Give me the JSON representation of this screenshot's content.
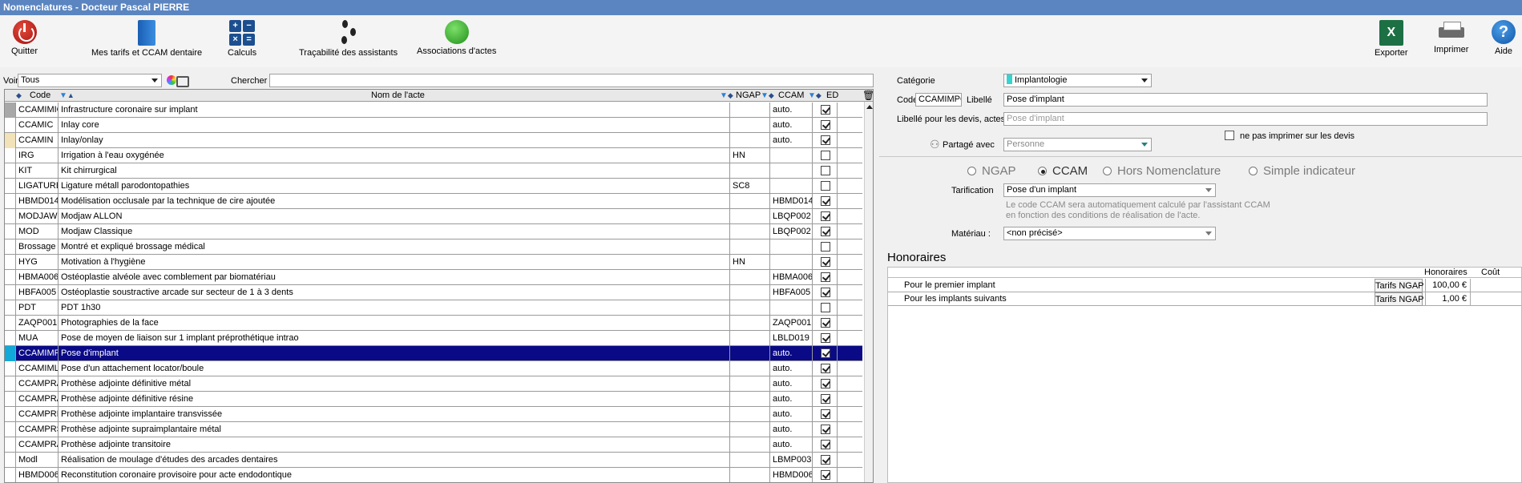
{
  "window": {
    "title": "Nomenclatures - Docteur Pascal PIERRE"
  },
  "toolbar": {
    "quit": "Quitter",
    "tarifs": "Mes tarifs et CCAM dentaire",
    "calculs": "Calculs",
    "calc_symbols": [
      "+",
      "−",
      "×",
      "="
    ],
    "tracabilite": "Traçabilité des assistants",
    "associations": "Associations d'actes",
    "export": "Exporter",
    "export_glyph": "X",
    "print": "Imprimer",
    "help": "Aide",
    "help_glyph": "?"
  },
  "filter": {
    "voir_label": "Voir",
    "voir_value": "Tous",
    "search_label": "Chercher",
    "search_value": ""
  },
  "grid": {
    "headers": {
      "code": "Code",
      "name": "Nom de l'acte",
      "ngap": "NGAP",
      "ccam": "CCAM",
      "ed": "ED"
    },
    "rows": [
      {
        "mark": "#a8a8a8",
        "code": "CCAMIMIC",
        "name": "Infrastructure coronaire sur implant",
        "ngap": "",
        "ccam": "auto.",
        "ed": true
      },
      {
        "mark": "",
        "code": "CCAMIC",
        "name": "Inlay core",
        "ngap": "",
        "ccam": "auto.",
        "ed": true
      },
      {
        "mark": "#f2e2b8",
        "code": "CCAMIN",
        "name": "Inlay/onlay",
        "ngap": "",
        "ccam": "auto.",
        "ed": true
      },
      {
        "mark": "",
        "code": "IRG",
        "name": "Irrigation à l'eau oxygénée",
        "ngap": "HN",
        "ccam": "",
        "ed": false
      },
      {
        "mark": "",
        "code": "KIT",
        "name": "Kit chirrurgical",
        "ngap": "",
        "ccam": "",
        "ed": false
      },
      {
        "mark": "",
        "code": "LIGATURE",
        "name": "Ligature métall parodontopathies",
        "ngap": "SC8",
        "ccam": "",
        "ed": false
      },
      {
        "mark": "",
        "code": "HBMD014",
        "name": "Modélisation occlusale par la technique de cire ajoutée",
        "ngap": "",
        "ccam": "HBMD014",
        "ed": true
      },
      {
        "mark": "",
        "code": "MODJAW",
        "name": "Modjaw ALLON",
        "ngap": "",
        "ccam": "LBQP002",
        "ed": true
      },
      {
        "mark": "",
        "code": "MOD",
        "name": "Modjaw Classique",
        "ngap": "",
        "ccam": "LBQP002",
        "ed": true
      },
      {
        "mark": "",
        "code": "Brossage",
        "name": "Montré et expliqué brossage médical",
        "ngap": "",
        "ccam": "",
        "ed": false
      },
      {
        "mark": "",
        "code": "HYG",
        "name": "Motivation à l'hygiène",
        "ngap": "HN",
        "ccam": "",
        "ed": true
      },
      {
        "mark": "",
        "code": "HBMA006",
        "name": "Ostéoplastie alvéole avec comblement par biomatériau",
        "ngap": "",
        "ccam": "HBMA006",
        "ed": true
      },
      {
        "mark": "",
        "code": "HBFA005",
        "name": "Ostéoplastie soustractive arcade sur secteur de 1 à 3 dents",
        "ngap": "",
        "ccam": "HBFA005",
        "ed": true
      },
      {
        "mark": "",
        "code": "PDT",
        "name": "PDT 1h30",
        "ngap": "",
        "ccam": "",
        "ed": false
      },
      {
        "mark": "",
        "code": "ZAQP001",
        "name": "Photographies de la face",
        "ngap": "",
        "ccam": "ZAQP001",
        "ed": true
      },
      {
        "mark": "",
        "code": "MUA",
        "name": "Pose de moyen de liaison sur 1 implant préprothétique intrao",
        "ngap": "",
        "ccam": "LBLD019",
        "ed": true
      },
      {
        "mark": "#12a8d8",
        "code": "CCAMIMPO",
        "name": "Pose d'implant",
        "ngap": "",
        "ccam": "auto.",
        "ed": true,
        "selected": true
      },
      {
        "mark": "",
        "code": "CCAMIMLI",
        "name": "Pose d'un attachement locator/boule",
        "ngap": "",
        "ccam": "auto.",
        "ed": true
      },
      {
        "mark": "",
        "code": "CCAMPRAM",
        "name": "Prothèse adjointe définitive métal",
        "ngap": "",
        "ccam": "auto.",
        "ed": true
      },
      {
        "mark": "",
        "code": "CCAMPRAR",
        "name": "Prothèse adjointe définitive résine",
        "ngap": "",
        "ccam": "auto.",
        "ed": true
      },
      {
        "mark": "",
        "code": "CCAMPRIT",
        "name": "Prothèse adjointe implantaire transvissée",
        "ngap": "",
        "ccam": "auto.",
        "ed": true
      },
      {
        "mark": "",
        "code": "CCAMPRSM",
        "name": "Prothèse adjointe supraimplantaire métal",
        "ngap": "",
        "ccam": "auto.",
        "ed": true
      },
      {
        "mark": "",
        "code": "CCAMPRAT",
        "name": "Prothèse adjointe transitoire",
        "ngap": "",
        "ccam": "auto.",
        "ed": true
      },
      {
        "mark": "",
        "code": "Modl",
        "name": "Réalisation de moulage d'études des arcades dentaires",
        "ngap": "",
        "ccam": "LBMP003",
        "ed": true
      },
      {
        "mark": "",
        "code": "HBMD006",
        "name": "Reconstitution coronaire provisoire pour acte endodontique",
        "ngap": "",
        "ccam": "HBMD006",
        "ed": true
      }
    ]
  },
  "detail": {
    "category_label": "Catégorie",
    "category_value": "Implantologie",
    "category_color": "#37d3d0",
    "code_label": "Code",
    "code_value": "CCAMIMPO",
    "libelle_label": "Libellé",
    "libelle_value": "Pose d'implant",
    "devis_label": "Libellé pour les devis, actes",
    "devis_placeholder": "Pose d'implant",
    "no_print_label": "ne pas imprimer sur les devis",
    "partage_label": "Partagé avec",
    "partage_value": "Personne",
    "modes": {
      "ngap": "NGAP",
      "ccam": "CCAM",
      "hors": "Hors Nomenclature",
      "simple": "Simple indicateur"
    },
    "selected_mode": "ccam",
    "tarification_label": "Tarification",
    "tarification_value": "Pose d'un implant",
    "hint_line1": "Le code CCAM sera automatiquement calculé par l'assistant CCAM",
    "hint_line2": "en fonction des conditions de réalisation de l'acte.",
    "materiau_label": "Matériau :",
    "materiau_value": "<non précisé>"
  },
  "honoraires": {
    "title": "Honoraires",
    "col_honoraires": "Honoraires",
    "col_cout": "Coût",
    "rows": [
      {
        "label": "Pour le premier implant",
        "tarif": "Tarifs NGAP",
        "amount": "100,00 €",
        "cout": ""
      },
      {
        "label": "Pour les implants suivants",
        "tarif": "Tarifs NGAP",
        "amount": "1,00 €",
        "cout": ""
      }
    ]
  }
}
